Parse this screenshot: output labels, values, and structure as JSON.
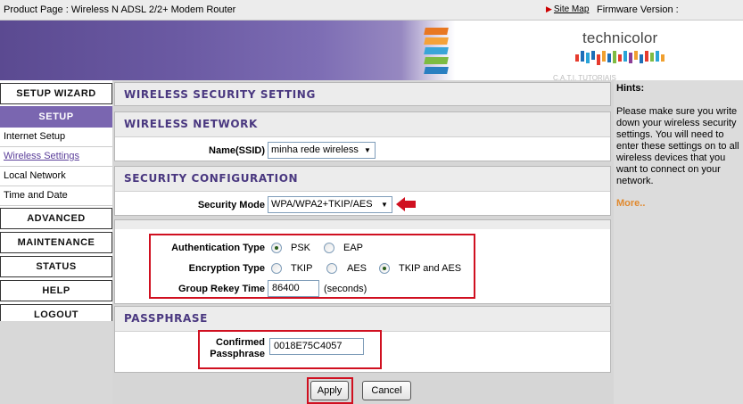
{
  "topbar": {
    "title": "Product Page : Wireless N ADSL 2/2+ Modem Router",
    "site_map": "Site Map",
    "firmware": "Firmware Version :"
  },
  "brand": {
    "logo": "technicolor",
    "watermark": "C.A.T.I. TUTORIAIS"
  },
  "nav": {
    "setup_wizard": "SETUP WIZARD",
    "setup": "SETUP",
    "sub": [
      "Internet Setup",
      "Wireless Settings",
      "Local Network",
      "Time and Date"
    ],
    "advanced": "ADVANCED",
    "maintenance": "MAINTENANCE",
    "status": "STATUS",
    "help": "HELP",
    "logout": "LOGOUT"
  },
  "page_title": "WIRELESS SECURITY SETTING",
  "wireless_network": {
    "header": "WIRELESS NETWORK",
    "ssid_label": "Name(SSID)",
    "ssid_value": "minha rede wireless"
  },
  "security": {
    "header": "SECURITY CONFIGURATION",
    "mode_label": "Security Mode",
    "mode_value": "WPA/WPA2+TKIP/AES"
  },
  "auth": {
    "auth_label": "Authentication Type",
    "psk": "PSK",
    "eap": "EAP",
    "selected_auth": "PSK",
    "enc_label": "Encryption Type",
    "tkip": "TKIP",
    "aes": "AES",
    "tkip_aes": "TKIP and AES",
    "selected_enc": "TKIP and AES",
    "rekey_label": "Group Rekey Time",
    "rekey_value": "86400",
    "rekey_unit": "(seconds)"
  },
  "passphrase": {
    "header": "PASSPHRASE",
    "label_line1": "Confirmed",
    "label_line2": "Passphrase",
    "value": "0018E75C4057"
  },
  "buttons": {
    "apply": "Apply",
    "cancel": "Cancel"
  },
  "hints": {
    "title": "Hints:",
    "body": "Please make sure you write down your wireless security settings. You will need to enter these settings on to all wireless devices that you want to connect on your network.",
    "more": "More.."
  },
  "colors": {
    "accent": "#7a66b0",
    "header_text": "#4a3880",
    "highlight": "#d01020",
    "more_link": "#e08a30"
  }
}
